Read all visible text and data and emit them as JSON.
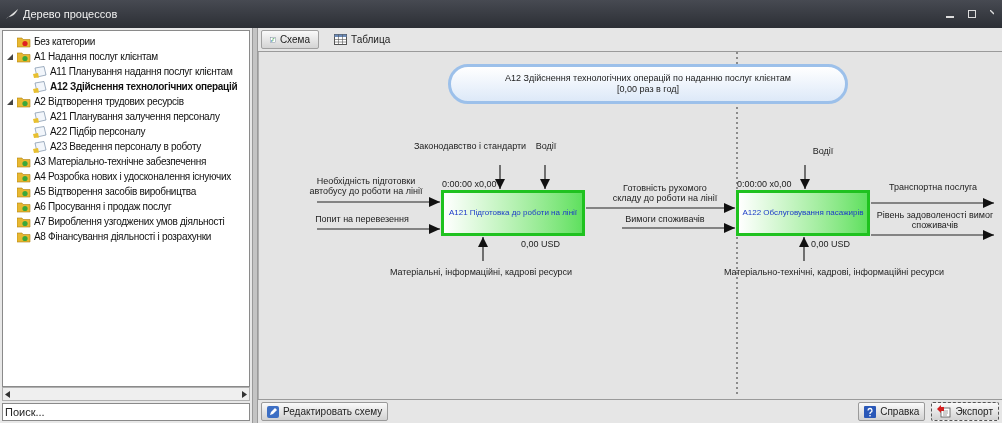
{
  "window": {
    "title": "Дерево процессов"
  },
  "tree": {
    "items": [
      {
        "label": "Без категории",
        "kind": "uncategorized",
        "selected": false
      },
      {
        "label": "A1 Надання послуг клієнтам",
        "kind": "category",
        "selected": false,
        "expanded": true,
        "children": [
          {
            "label": "A11 Планування надання послуг клієнтам",
            "kind": "process",
            "selected": false
          },
          {
            "label": "A12 Здійснення технологічних операцій",
            "kind": "process",
            "selected": true
          }
        ]
      },
      {
        "label": "A2 Відтворення трудових ресурсів",
        "kind": "category",
        "selected": false,
        "expanded": true,
        "children": [
          {
            "label": "A21 Планування залучення персоналу",
            "kind": "process",
            "selected": false
          },
          {
            "label": "A22 Підбір персоналу",
            "kind": "process",
            "selected": false
          },
          {
            "label": "A23 Введення персоналу в роботу",
            "kind": "process",
            "selected": false
          }
        ]
      },
      {
        "label": "A3 Матеріально-технічне забезпечення",
        "kind": "category",
        "selected": false
      },
      {
        "label": "A4 Розробка нових і удосконалення існуючих",
        "kind": "category",
        "selected": false
      },
      {
        "label": "A5 Відтворення засобів виробництва",
        "kind": "category",
        "selected": false
      },
      {
        "label": "A6 Просування і продаж послуг",
        "kind": "category",
        "selected": false
      },
      {
        "label": "A7 Вироблення узгоджених умов діяльності",
        "kind": "category",
        "selected": false
      },
      {
        "label": "A8 Фінансування діяльності і розрахунки",
        "kind": "category",
        "selected": false
      }
    ]
  },
  "search": {
    "placeholder": "Поиск..."
  },
  "tabs": [
    {
      "label": "Схема",
      "kind": "scheme",
      "selected": true
    },
    {
      "label": "Таблица",
      "kind": "table",
      "selected": false
    }
  ],
  "diagram": {
    "context": {
      "lines": [
        "A12 Здійснення технологічних операцій по наданню послуг клієнтам",
        "[0,00 раз в год]"
      ]
    },
    "boxes": [
      {
        "label": "A121 Підготовка до роботи на лінії",
        "time": "0:00:00 x0,00",
        "cost": "0,00 USD"
      },
      {
        "label": "A122 Обслуговування пасажирів",
        "time": "0:00:00 x0,00",
        "cost": "0,00 USD"
      }
    ],
    "flows": [
      {
        "kind": "control",
        "label": "Законодавство і стандарти"
      },
      {
        "kind": "control",
        "label": "Водії"
      },
      {
        "kind": "input",
        "label": "Необхідність підготовки\nавтобусу до роботи на лінії"
      },
      {
        "kind": "input",
        "label": "Попит на перевезення"
      },
      {
        "kind": "mechanism",
        "label": "Матеріальні, інформаційні, кадрові ресурси"
      },
      {
        "kind": "output",
        "label": "Готовність рухомого\nскладу до роботи на лінії"
      },
      {
        "kind": "input",
        "label": "Вимоги споживачів"
      },
      {
        "kind": "control",
        "label": "Водії"
      },
      {
        "kind": "mechanism",
        "label": "Матеріально-технічні, кадрові, інформаційні ресурси"
      },
      {
        "kind": "output",
        "label": "Транспортна послуга"
      },
      {
        "kind": "output",
        "label": "Рівень задоволеності вимог\nспоживачів"
      }
    ]
  },
  "bottom_buttons": [
    {
      "label": "Редактировать схему",
      "kind": "edit"
    },
    {
      "label": "Справка",
      "kind": "help"
    },
    {
      "label": "Экспорт",
      "kind": "export"
    }
  ]
}
